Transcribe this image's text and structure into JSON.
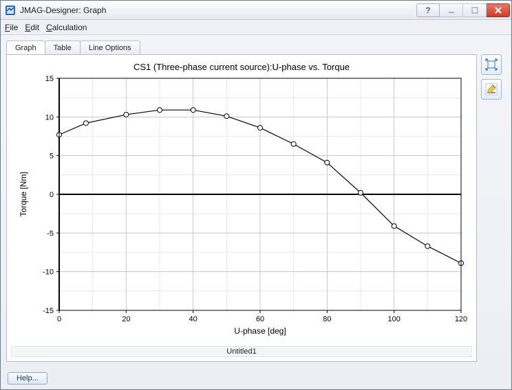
{
  "window": {
    "title": "JMAG-Designer: Graph"
  },
  "menu": {
    "file": "File",
    "edit": "Edit",
    "calc": "Calculation"
  },
  "tabs": {
    "graph": "Graph",
    "table": "Table",
    "lineopts": "Line Options"
  },
  "chart_data": {
    "type": "line",
    "title": "CS1 (Three-phase current source):U-phase vs. Torque",
    "xlabel": "U-phase [deg]",
    "ylabel": "Torque [Nm]",
    "xlim": [
      0,
      120
    ],
    "ylim": [
      -15,
      15
    ],
    "xticks": [
      0,
      20,
      40,
      60,
      80,
      100,
      120
    ],
    "yticks": [
      -15,
      -10,
      -5,
      0,
      5,
      10,
      15
    ],
    "minor_x": 10,
    "minor_y": 2.5,
    "x": [
      0,
      8,
      20,
      30,
      40,
      50,
      60,
      70,
      80,
      90,
      100,
      110,
      120
    ],
    "y": [
      7.7,
      9.2,
      10.3,
      10.9,
      10.9,
      10.1,
      8.6,
      6.5,
      4.1,
      0.2,
      -4.1,
      -6.7,
      -8.9
    ]
  },
  "legend": {
    "label": "Untitled1"
  },
  "footer": {
    "help": "Help..."
  },
  "tool_icons": {
    "fit": "fit-extents-icon",
    "edit": "edit-style-icon"
  }
}
